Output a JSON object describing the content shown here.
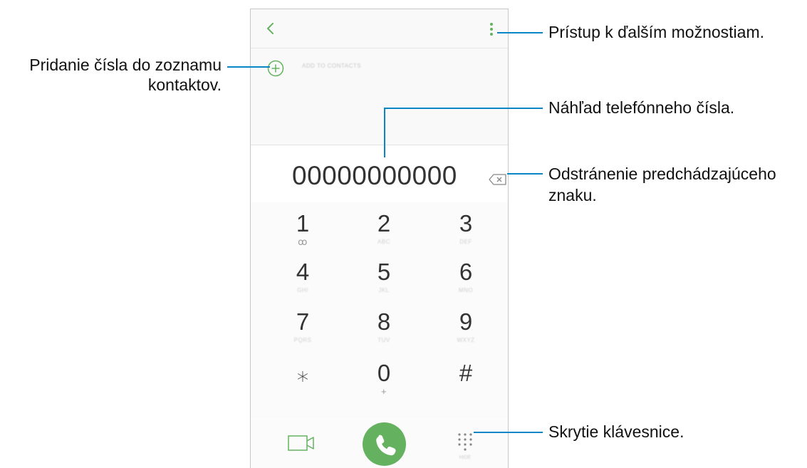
{
  "screen": {
    "add_to_contacts": "ADD TO CONTACTS",
    "number": "00000000000",
    "keys": [
      {
        "digit": "1",
        "letters": "ꝏ"
      },
      {
        "digit": "2",
        "letters": "ABC"
      },
      {
        "digit": "3",
        "letters": "DEF"
      },
      {
        "digit": "4",
        "letters": "GHI"
      },
      {
        "digit": "5",
        "letters": "JKL"
      },
      {
        "digit": "6",
        "letters": "MNO"
      },
      {
        "digit": "7",
        "letters": "PQRS"
      },
      {
        "digit": "8",
        "letters": "TUV"
      },
      {
        "digit": "9",
        "letters": "WXYZ"
      },
      {
        "digit": "⁎",
        "letters": ""
      },
      {
        "digit": "0",
        "letters": "+"
      },
      {
        "digit": "#",
        "letters": ""
      }
    ],
    "hide_label": "HIDE"
  },
  "annotations": {
    "more_options": "Prístup k ďalším možnostiam.",
    "add_contact_line1": "Pridanie čísla do zoznamu",
    "add_contact_line2": "kontaktov.",
    "preview": "Náhľad telefónneho čísla.",
    "delete_line1": "Odstránenie predchádzajúceho",
    "delete_line2": "znaku.",
    "hide_keypad": "Skrytie klávesnice."
  },
  "icons": {
    "back": "chevron-left-icon",
    "more": "more-vertical-icon",
    "add": "add-circle-icon",
    "backspace": "backspace-icon",
    "video": "video-call-icon",
    "call": "phone-icon",
    "keypad": "dialpad-icon"
  },
  "colors": {
    "accent_green": "#64b25f",
    "annotation_line": "#0a86c6"
  }
}
